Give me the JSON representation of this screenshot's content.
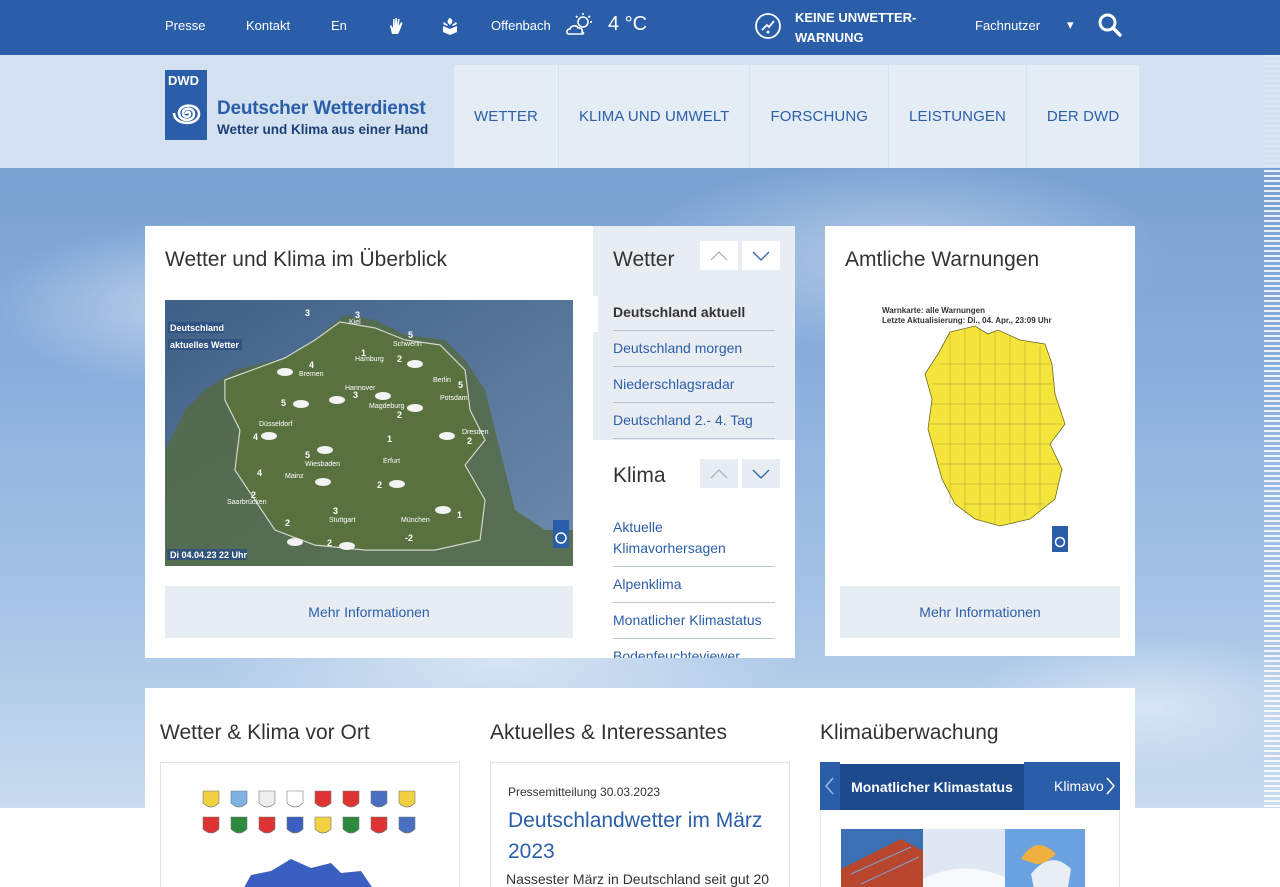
{
  "topbar": {
    "links": [
      "Presse",
      "Kontakt",
      "En"
    ],
    "location": "Offenbach",
    "temperature": "4 °C",
    "warning": "KEINE UNWETTER-WARNUNG",
    "fachnutzer": "Fachnutzer",
    "caret": "▾"
  },
  "header": {
    "logo_abbr": "DWD",
    "logo_name": "Deutscher Wetterdienst",
    "logo_claim": "Wetter und Klima aus einer Hand",
    "nav": [
      "WETTER",
      "KLIMA UND UMWELT",
      "FORSCHUNG",
      "LEISTUNGEN",
      "DER DWD"
    ]
  },
  "overview": {
    "title": "Wetter und Klima im Überblick",
    "map_label_1": "Deutschland",
    "map_label_2": "aktuelles Wetter",
    "map_timestamp": "Di 04.04.23 22 Uhr",
    "more": "Mehr Informationen"
  },
  "side": {
    "wetter_title": "Wetter",
    "wetter_links": [
      "Deutschland aktuell",
      "Deutschland morgen",
      "Niederschlagsradar",
      "Deutschland 2.- 4. Tag"
    ],
    "klima_title": "Klima",
    "klima_links": [
      "Aktuelle Klimavorhersagen",
      "Alpenklima",
      "Monatlicher Klimastatus",
      "Bodenfeuchteviewer"
    ]
  },
  "warnings": {
    "title": "Amtliche Warnungen",
    "map_title_1": "Warnkarte: alle Warnungen",
    "map_title_2": "Letzte Aktualisierung: Di., 04. Apr., 23:09 Uhr",
    "more": "Mehr Informationen"
  },
  "bottom": {
    "vor_ort_title": "Wetter & Klima vor Ort",
    "aktuelles_title": "Aktuelles & Interessantes",
    "press_date": "Pressemitteilung 30.03.2023",
    "press_title": "Deutschlandwetter im März 2023",
    "press_text": "Nassester März in Deutschland seit gut 20",
    "klima_title": "Klimaüberwachung",
    "tab_active": "Monatlicher Klimastatus",
    "tab_next": "Klimavo"
  },
  "colors": {
    "brand": "#2b5ea9",
    "warn_yellow": "#f4e43c"
  },
  "map_cities": [
    "Kiel",
    "Schwerin",
    "Hamburg",
    "Bremen",
    "Hannover",
    "Berlin",
    "Potsdam",
    "Magdeburg",
    "Düsseldorf",
    "Erfurt",
    "Dresden",
    "Wiesbaden",
    "Mainz",
    "Saarbrücken",
    "Stuttgart",
    "München"
  ],
  "map_temps": [
    "3",
    "3",
    "5",
    "1",
    "2",
    "4",
    "3",
    "5",
    "5",
    "2",
    "4",
    "1",
    "5",
    "2",
    "4",
    "2",
    "3",
    "1",
    "2",
    "2",
    "-2"
  ]
}
